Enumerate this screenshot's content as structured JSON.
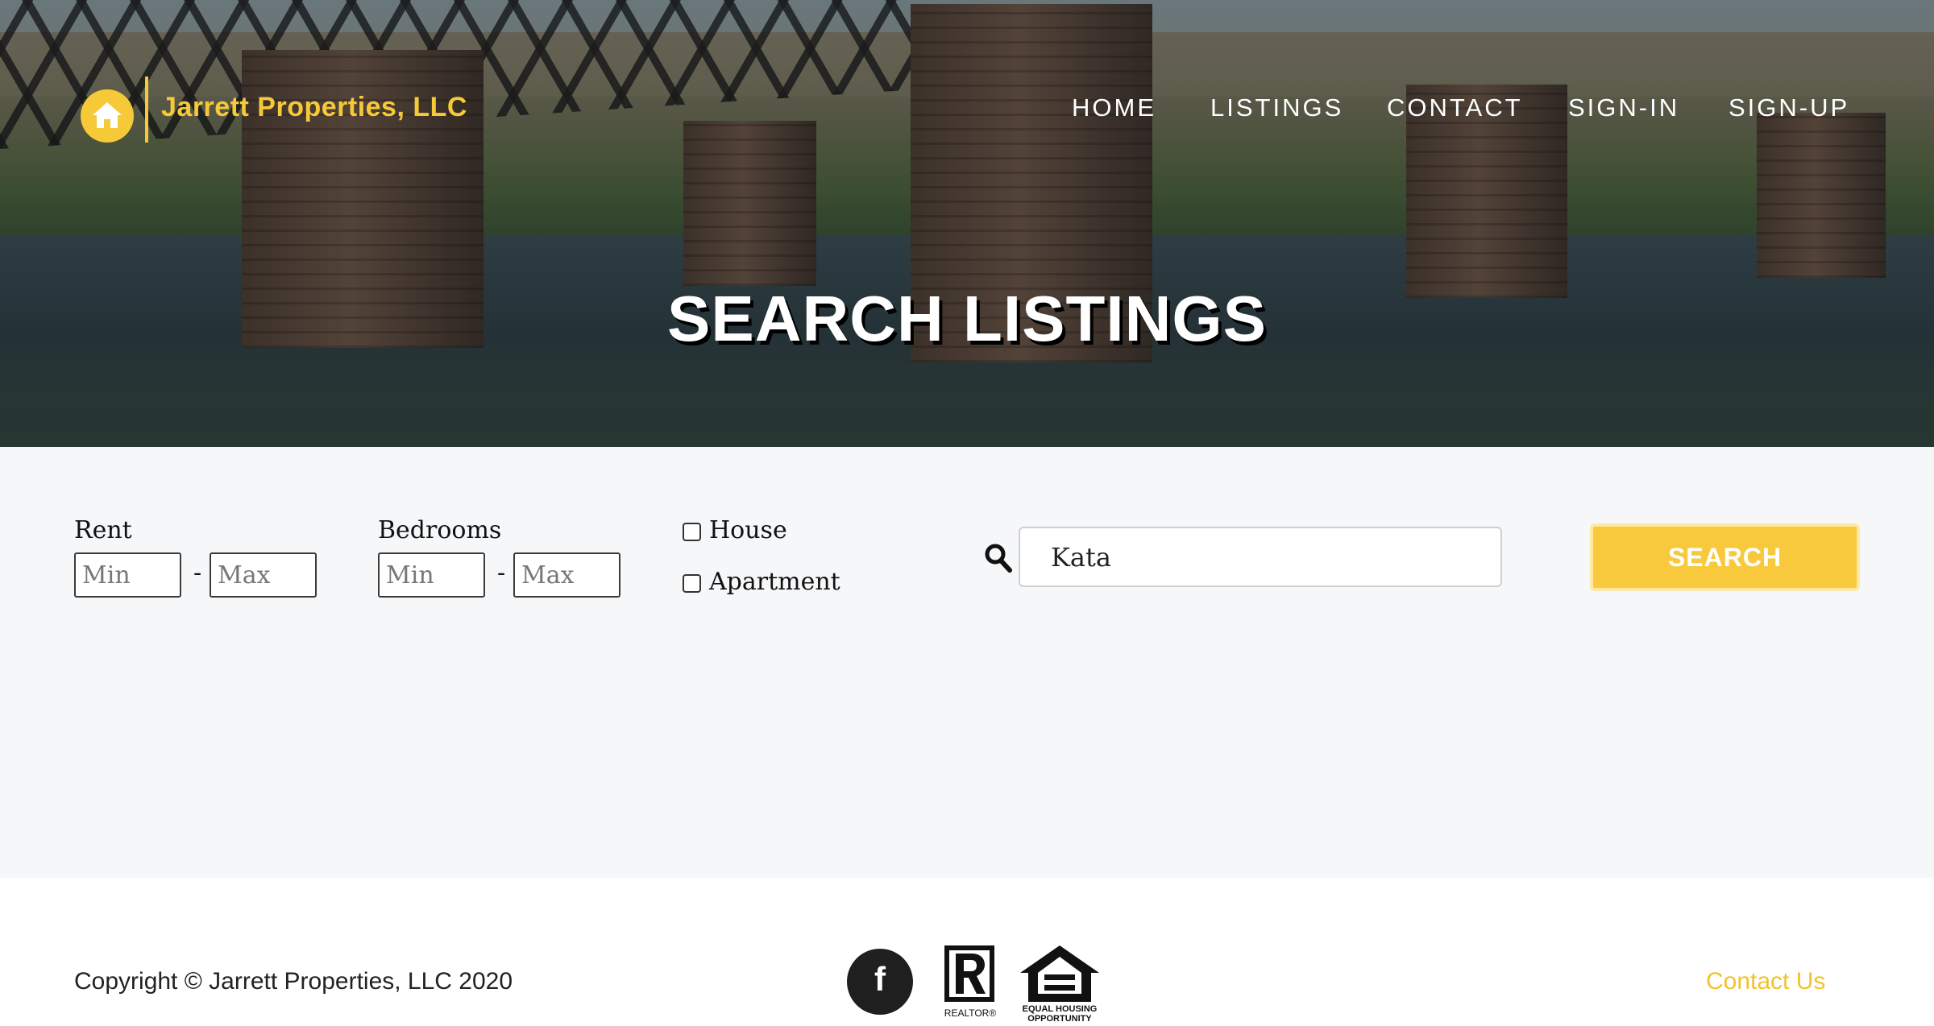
{
  "brand": {
    "name": "Jarrett Properties, LLC",
    "accent_color": "#f6c938",
    "logo_icon": "house-icon"
  },
  "nav": {
    "items": [
      {
        "label": "HOME"
      },
      {
        "label": "LISTINGS"
      },
      {
        "label": "CONTACT"
      },
      {
        "label": "SIGN-IN"
      },
      {
        "label": "SIGN-UP"
      }
    ]
  },
  "hero": {
    "title": "SEARCH LISTINGS"
  },
  "filters": {
    "rent": {
      "label": "Rent",
      "min_placeholder": "Min",
      "max_placeholder": "Max",
      "min_value": "",
      "max_value": ""
    },
    "bedrooms": {
      "label": "Bedrooms",
      "min_placeholder": "Min",
      "max_placeholder": "Max",
      "min_value": "",
      "max_value": ""
    },
    "separator": "-",
    "types": [
      {
        "label": "House",
        "checked": false
      },
      {
        "label": "Apartment",
        "checked": false
      }
    ],
    "search": {
      "icon": "search-icon",
      "value": "Kata"
    },
    "search_button_label": "SEARCH"
  },
  "footer": {
    "copyright": "Copyright © Jarrett Properties, LLC 2020",
    "facebook_icon": "facebook-icon",
    "realtor_logo_text": "REALTOR®",
    "equal_housing_text_line1": "EQUAL HOUSING",
    "equal_housing_text_line2": "OPPORTUNITY",
    "contact_link": "Contact Us"
  }
}
